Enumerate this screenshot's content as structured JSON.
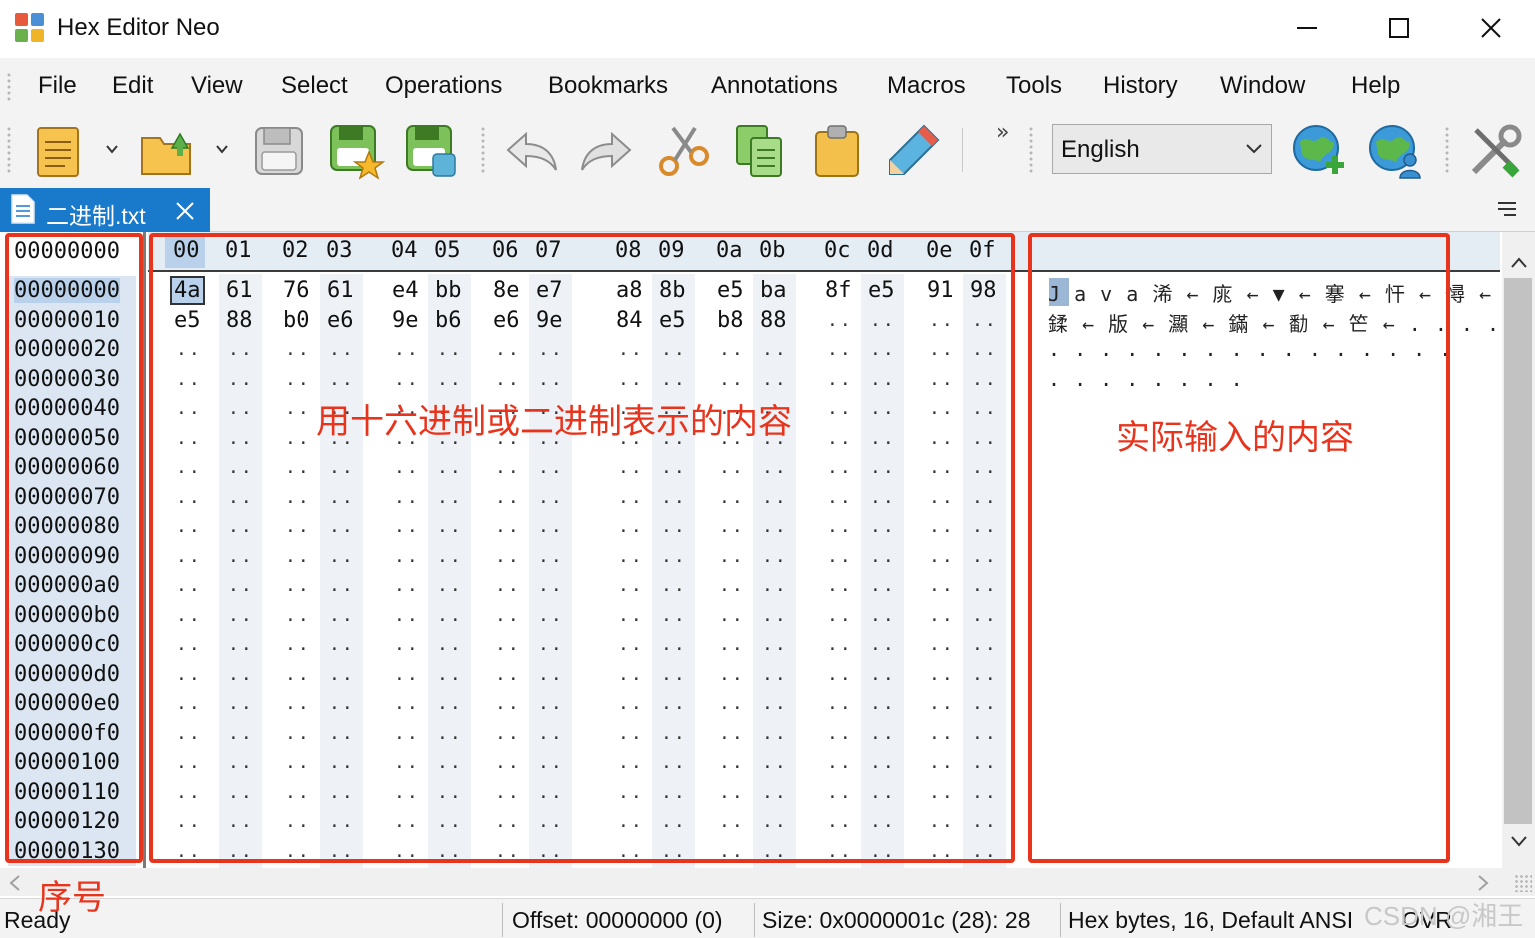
{
  "window": {
    "title": "Hex Editor Neo",
    "minimize_icon": "minimize-icon",
    "maximize_icon": "maximize-icon",
    "close_icon": "close-icon"
  },
  "menu": [
    "File",
    "Edit",
    "View",
    "Select",
    "Operations",
    "Bookmarks",
    "Annotations",
    "Macros",
    "Tools",
    "History",
    "Window",
    "Help"
  ],
  "toolbar": {
    "buttons": [
      "new-document-icon",
      "open-folder-icon",
      "save-disk-icon",
      "save-as-star-icon",
      "save-all-icon",
      "undo-icon",
      "redo-icon",
      "cut-scissors-icon",
      "copy-icon",
      "paste-clipboard-icon",
      "edit-pencil-icon",
      "add-globe-icon",
      "globe-user-icon",
      "settings-tools-icon"
    ],
    "overflow": "»",
    "language_value": "English"
  },
  "tab": {
    "label": "二进制.txt",
    "icon": "document-icon"
  },
  "editor": {
    "offset_header": "00000000",
    "column_headers": [
      "00",
      "01",
      "02",
      "03",
      "04",
      "05",
      "06",
      "07",
      "08",
      "09",
      "0a",
      "0b",
      "0c",
      "0d",
      "0e",
      "0f"
    ],
    "offsets": [
      "00000000",
      "00000010",
      "00000020",
      "00000030",
      "00000040",
      "00000050",
      "00000060",
      "00000070",
      "00000080",
      "00000090",
      "000000a0",
      "000000b0",
      "000000c0",
      "000000d0",
      "000000e0",
      "000000f0",
      "00000100",
      "00000110",
      "00000120",
      "00000130"
    ],
    "hex_rows": [
      [
        "4a",
        "61",
        "76",
        "61",
        "e4",
        "bb",
        "8e",
        "e7",
        "a8",
        "8b",
        "e5",
        "ba",
        "8f",
        "e5",
        "91",
        "98"
      ],
      [
        "e5",
        "88",
        "b0",
        "e6",
        "9e",
        "b6",
        "e6",
        "9e",
        "84",
        "e5",
        "b8",
        "88"
      ]
    ],
    "text_lines": [
      "J a v a 浠 ← 庣 ← ▼ ← 搴 ← 忓 ← 憳 ←",
      "鍒 ← 版 ← 灦 ← 鏋 ← 勫 ← 笀 ← . . . .",
      ". . . . . . . . . . . . . . . .",
      ". . . . . . . ."
    ]
  },
  "annotations": {
    "hex_label": "用十六进制或二进制表示的内容",
    "text_label": "实际输入的内容",
    "offset_label": "序号",
    "color": "#e8341c"
  },
  "status": {
    "ready": "Ready",
    "offset": "Offset: 00000000 (0)",
    "size": "Size: 0x0000001c (28): 28",
    "mode": "Hex bytes, 16, Default ANSI",
    "ovr": "OVR",
    "watermark": "CSDN @湘王"
  }
}
